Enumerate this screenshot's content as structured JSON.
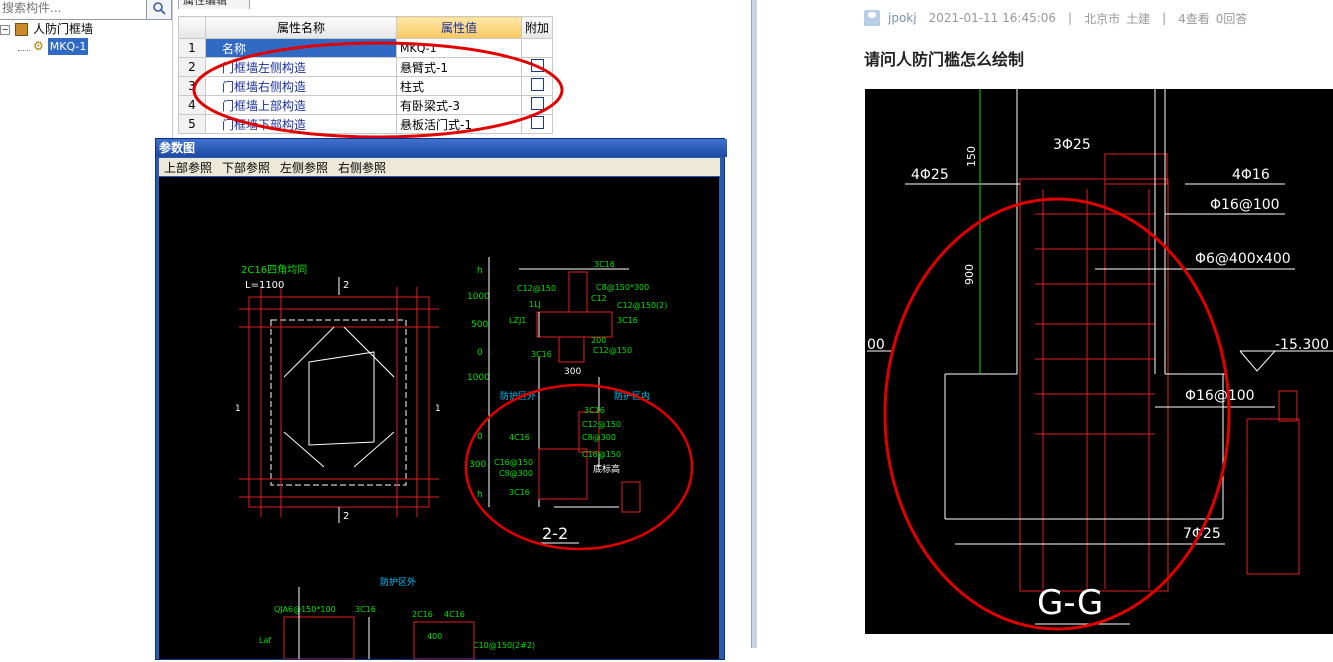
{
  "tree": {
    "search_placeholder": "搜索构件...",
    "root_label": "人防门框墙",
    "child_label": "MKQ-1"
  },
  "prop_editor": {
    "tab_label": "属性编辑",
    "headers": {
      "num": "",
      "name": "属性名称",
      "value": "属性值",
      "extra": "附加"
    },
    "rows": [
      {
        "num": "1",
        "name": "名称",
        "value": "MKQ-1",
        "has_check": false
      },
      {
        "num": "2",
        "name": "门框墙左侧构造",
        "value": "悬臂式-1",
        "has_check": true
      },
      {
        "num": "3",
        "name": "门框墙右侧构造",
        "value": "柱式",
        "has_check": true
      },
      {
        "num": "4",
        "name": "门框墙上部构造",
        "value": "有卧梁式-3",
        "has_check": true
      },
      {
        "num": "5",
        "name": "门框墙下部构造",
        "value": "悬板活门式-1",
        "has_check": true
      }
    ]
  },
  "ref_window": {
    "title": "参数图",
    "menu": [
      "上部参照",
      "下部参照",
      "左侧参照",
      "右侧参照"
    ],
    "cad": {
      "label_2c16": "2C16四角均同",
      "label_l": "L=1100",
      "sec_1": "1",
      "sec_2": "2",
      "dims": [
        "h",
        "1000",
        "500",
        "0",
        "1000",
        "0",
        "300",
        "h"
      ],
      "top_labels": [
        "3C16",
        "C12@150",
        "C8@150*300",
        "1LJ",
        "C12",
        "LZJ1",
        "C12@150(2)",
        "3C16",
        "3C16",
        "200",
        "C12@150"
      ],
      "dim_300": "300",
      "zone_out": "防护区外",
      "zone_in": "防护区内",
      "mid_labels": [
        "3C16",
        "C12@150",
        "C8@300",
        "4C16",
        "C16@150",
        "C16@150",
        "C8@300",
        "底标高",
        "3C16"
      ],
      "section_22": "2-2",
      "bottom_zone": "防护区外",
      "bottom_labels": [
        "QJA6@150*100",
        "3C16",
        "2C16",
        "4C16",
        "Laf",
        "400",
        "C10@150(2#2)"
      ]
    }
  },
  "qa": {
    "user": "jpokj",
    "datetime": "2021-01-11 16:45:06",
    "sep": "|",
    "location": "北京市",
    "category": "土建",
    "views": "4查看",
    "answers": "0回答",
    "title": "请问人防门槛怎么绘制",
    "cad": {
      "top_rebar": "3Φ25",
      "left_rebar": "4Φ25",
      "dim_150": "150",
      "right_rebar": "4Φ16",
      "stirrup1": "Φ16@100",
      "stirrup2": "Φ6@400x400",
      "dim_900": "900",
      "left_val": "00",
      "elev": "-15.300",
      "stirrup3": "Φ16@100",
      "bottom_rebar": "7Φ25",
      "section": "G-G"
    }
  },
  "colors": {
    "highlight": "#316ac5",
    "annotation_red": "#e00000",
    "cad_green": "#00e000",
    "cad_red": "#e02020"
  }
}
